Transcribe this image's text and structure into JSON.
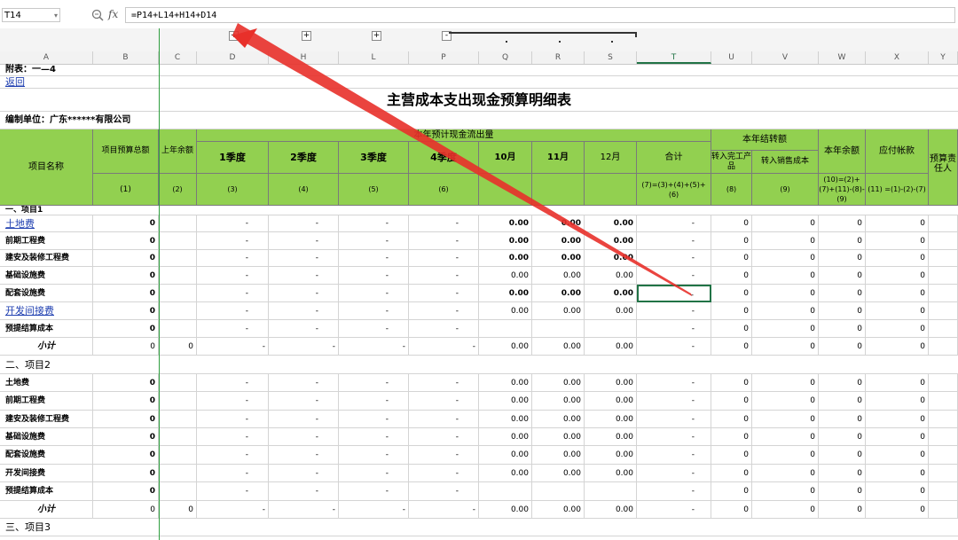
{
  "formula_bar": {
    "cell_ref": "T14",
    "fx": "fx",
    "formula": "=P14+L14+H14+D14"
  },
  "outline": {
    "collapse": "-",
    "expand": "+"
  },
  "columns": [
    "A",
    "B",
    "C",
    "D",
    "H",
    "L",
    "P",
    "Q",
    "R",
    "S",
    "T",
    "U",
    "V",
    "W",
    "X",
    "Y"
  ],
  "header_lines": {
    "attachment": "附表：一—4",
    "back_link": "返回",
    "title": "主营成本支出现金预算明细表",
    "unit": "编制单位：广东******有限公司"
  },
  "table_header": {
    "project_name": "项目名称",
    "budget_total": "项目预算总额",
    "last_balance": "上年余额",
    "cashflow_group": "本年预计现金流出量",
    "q1": "1季度",
    "q2": "2季度",
    "q3": "3季度",
    "q4": "4季度",
    "m10": "10月",
    "m11": "11月",
    "m12": "12月",
    "total": "合计",
    "carry_group": "本年结转额",
    "carry_finished": "转入完工产品",
    "carry_sales": "转入销售成本",
    "year_balance": "本年余额",
    "payable": "应付帐款",
    "budget_owner": "预算责任人",
    "idx": {
      "b": "(1)",
      "c": "(2)",
      "d": "(3)",
      "h": "(4)",
      "l": "(5)",
      "p": "(6)",
      "t": "(7)=(3)+(4)+(5)+(6)",
      "u": "(8)",
      "v": "(9)",
      "w": "(10)=(2)+(7)+(11)-(8)-(9)",
      "x": "(11) =(1)-(2)-(7)"
    }
  },
  "rows": [
    {
      "type": "section",
      "label": "一、项目1",
      "bold": true
    },
    {
      "type": "item",
      "label": "土地费",
      "link": true,
      "b": "0",
      "c": "",
      "d": "-",
      "h": "-",
      "l": "-",
      "p": "-",
      "q": "0.00",
      "r": "0.00",
      "s": "0.00",
      "t": "-",
      "u": "0",
      "v": "0",
      "w": "0",
      "x": "0",
      "bm": true
    },
    {
      "type": "item",
      "label": "前期工程费",
      "b": "0",
      "c": "",
      "d": "-",
      "h": "-",
      "l": "-",
      "p": "-",
      "q": "0.00",
      "r": "0.00",
      "s": "0.00",
      "t": "-",
      "u": "0",
      "v": "0",
      "w": "0",
      "x": "0",
      "bm": true
    },
    {
      "type": "item",
      "label": "建安及装修工程费",
      "b": "0",
      "c": "",
      "d": "-",
      "h": "-",
      "l": "-",
      "p": "-",
      "q": "0.00",
      "r": "0.00",
      "s": "0.00",
      "t": "-",
      "u": "0",
      "v": "0",
      "w": "0",
      "x": "0",
      "bm": true
    },
    {
      "type": "item",
      "label": "基础设施费",
      "b": "0",
      "c": "",
      "d": "-",
      "h": "-",
      "l": "-",
      "p": "-",
      "q": "0.00",
      "r": "0.00",
      "s": "0.00",
      "t": "-",
      "u": "0",
      "v": "0",
      "w": "0",
      "x": "0",
      "bm": false
    },
    {
      "type": "item",
      "label": "配套设施费",
      "b": "0",
      "c": "",
      "d": "-",
      "h": "-",
      "l": "-",
      "p": "-",
      "q": "0.00",
      "r": "0.00",
      "s": "0.00",
      "t": "-",
      "u": "0",
      "v": "0",
      "w": "0",
      "x": "0",
      "bm": true,
      "sel": true
    },
    {
      "type": "item",
      "label": "开发间接费",
      "link": true,
      "b": "0",
      "c": "",
      "d": "-",
      "h": "-",
      "l": "-",
      "p": "-",
      "q": "0.00",
      "r": "0.00",
      "s": "0.00",
      "t": "-",
      "u": "0",
      "v": "0",
      "w": "0",
      "x": "0",
      "bm": false
    },
    {
      "type": "item",
      "label": "预提结算成本",
      "b": "0",
      "c": "",
      "d": "-",
      "h": "-",
      "l": "-",
      "p": "-",
      "q": "",
      "r": "",
      "s": "",
      "t": "-",
      "u": "0",
      "v": "0",
      "w": "0",
      "x": "0",
      "bm": false
    },
    {
      "type": "subtotal",
      "label": "小计",
      "b": "0",
      "c": "0",
      "d": "-",
      "h": "-",
      "l": "-",
      "p": "-",
      "q": "0.00",
      "r": "0.00",
      "s": "0.00",
      "t": "-",
      "u": "0",
      "v": "0",
      "w": "0",
      "x": "0"
    },
    {
      "type": "section",
      "label": "二、项目2",
      "bold": false
    },
    {
      "type": "item",
      "label": "土地费",
      "b": "0",
      "c": "",
      "d": "-",
      "h": "-",
      "l": "-",
      "p": "-",
      "q": "0.00",
      "r": "0.00",
      "s": "0.00",
      "t": "-",
      "u": "0",
      "v": "0",
      "w": "0",
      "x": "0",
      "bm": false
    },
    {
      "type": "item",
      "label": "前期工程费",
      "b": "0",
      "c": "",
      "d": "-",
      "h": "-",
      "l": "-",
      "p": "-",
      "q": "0.00",
      "r": "0.00",
      "s": "0.00",
      "t": "-",
      "u": "0",
      "v": "0",
      "w": "0",
      "x": "0",
      "bm": false
    },
    {
      "type": "item",
      "label": "建安及装修工程费",
      "b": "0",
      "c": "",
      "d": "-",
      "h": "-",
      "l": "-",
      "p": "-",
      "q": "0.00",
      "r": "0.00",
      "s": "0.00",
      "t": "-",
      "u": "0",
      "v": "0",
      "w": "0",
      "x": "0",
      "bm": false
    },
    {
      "type": "item",
      "label": "基础设施费",
      "b": "0",
      "c": "",
      "d": "-",
      "h": "-",
      "l": "-",
      "p": "-",
      "q": "0.00",
      "r": "0.00",
      "s": "0.00",
      "t": "-",
      "u": "0",
      "v": "0",
      "w": "0",
      "x": "0",
      "bm": false
    },
    {
      "type": "item",
      "label": "配套设施费",
      "b": "0",
      "c": "",
      "d": "-",
      "h": "-",
      "l": "-",
      "p": "-",
      "q": "0.00",
      "r": "0.00",
      "s": "0.00",
      "t": "-",
      "u": "0",
      "v": "0",
      "w": "0",
      "x": "0",
      "bm": false
    },
    {
      "type": "item",
      "label": "开发间接费",
      "b": "0",
      "c": "",
      "d": "-",
      "h": "-",
      "l": "-",
      "p": "-",
      "q": "0.00",
      "r": "0.00",
      "s": "0.00",
      "t": "-",
      "u": "0",
      "v": "0",
      "w": "0",
      "x": "0",
      "bm": false
    },
    {
      "type": "item",
      "label": "预提结算成本",
      "b": "0",
      "c": "",
      "d": "-",
      "h": "-",
      "l": "-",
      "p": "-",
      "q": "",
      "r": "",
      "s": "",
      "t": "-",
      "u": "0",
      "v": "0",
      "w": "0",
      "x": "0",
      "bm": false
    },
    {
      "type": "subtotal",
      "label": "小计",
      "b": "0",
      "c": "0",
      "d": "-",
      "h": "-",
      "l": "-",
      "p": "-",
      "q": "0.00",
      "r": "0.00",
      "s": "0.00",
      "t": "-",
      "u": "0",
      "v": "0",
      "w": "0",
      "x": "0"
    },
    {
      "type": "section",
      "label": "三、项目3",
      "bold": false
    }
  ],
  "colors": {
    "header_green": "#92d050",
    "selection": "#217346",
    "arrow": "#e8302a",
    "link": "#1f3fb0"
  }
}
